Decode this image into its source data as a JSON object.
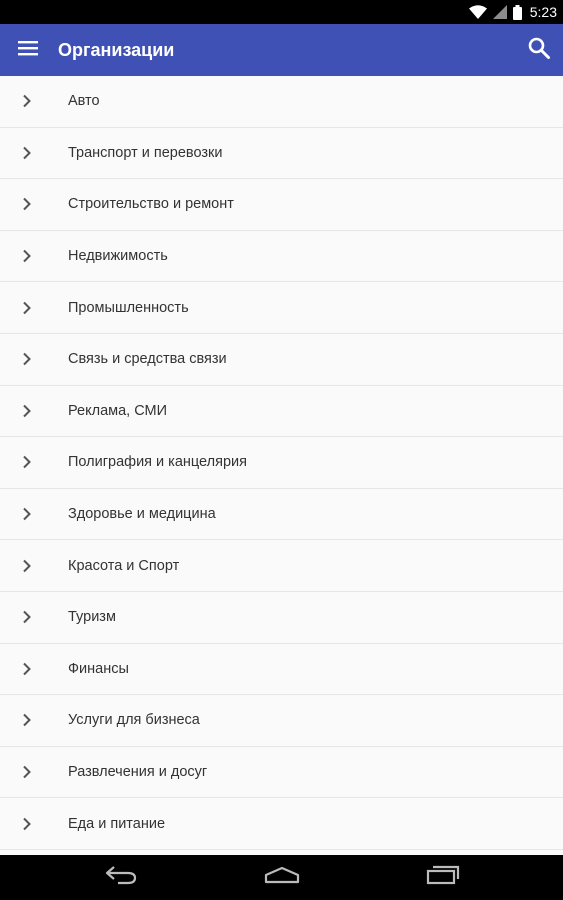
{
  "status_bar": {
    "time": "5:23",
    "icons": [
      "wifi-icon",
      "signal-icon",
      "battery-icon"
    ]
  },
  "app_bar": {
    "title": "Организации",
    "menu_icon": "menu-icon",
    "search_icon": "search-icon",
    "color": "#3f51b5"
  },
  "categories": [
    {
      "label": "Авто"
    },
    {
      "label": "Транспорт и перевозки"
    },
    {
      "label": "Строительство и ремонт"
    },
    {
      "label": "Недвижимость"
    },
    {
      "label": "Промышленность"
    },
    {
      "label": "Связь и средства связи"
    },
    {
      "label": "Реклама, СМИ"
    },
    {
      "label": "Полиграфия и канцелярия"
    },
    {
      "label": "Здоровье и медицина"
    },
    {
      "label": "Красота и Спорт"
    },
    {
      "label": "Туризм"
    },
    {
      "label": "Финансы"
    },
    {
      "label": "Услуги для бизнеса"
    },
    {
      "label": "Развлечения и досуг"
    },
    {
      "label": "Еда и питание"
    }
  ],
  "nav_bar": {
    "icons": [
      "back-icon",
      "home-icon",
      "recents-icon"
    ]
  }
}
